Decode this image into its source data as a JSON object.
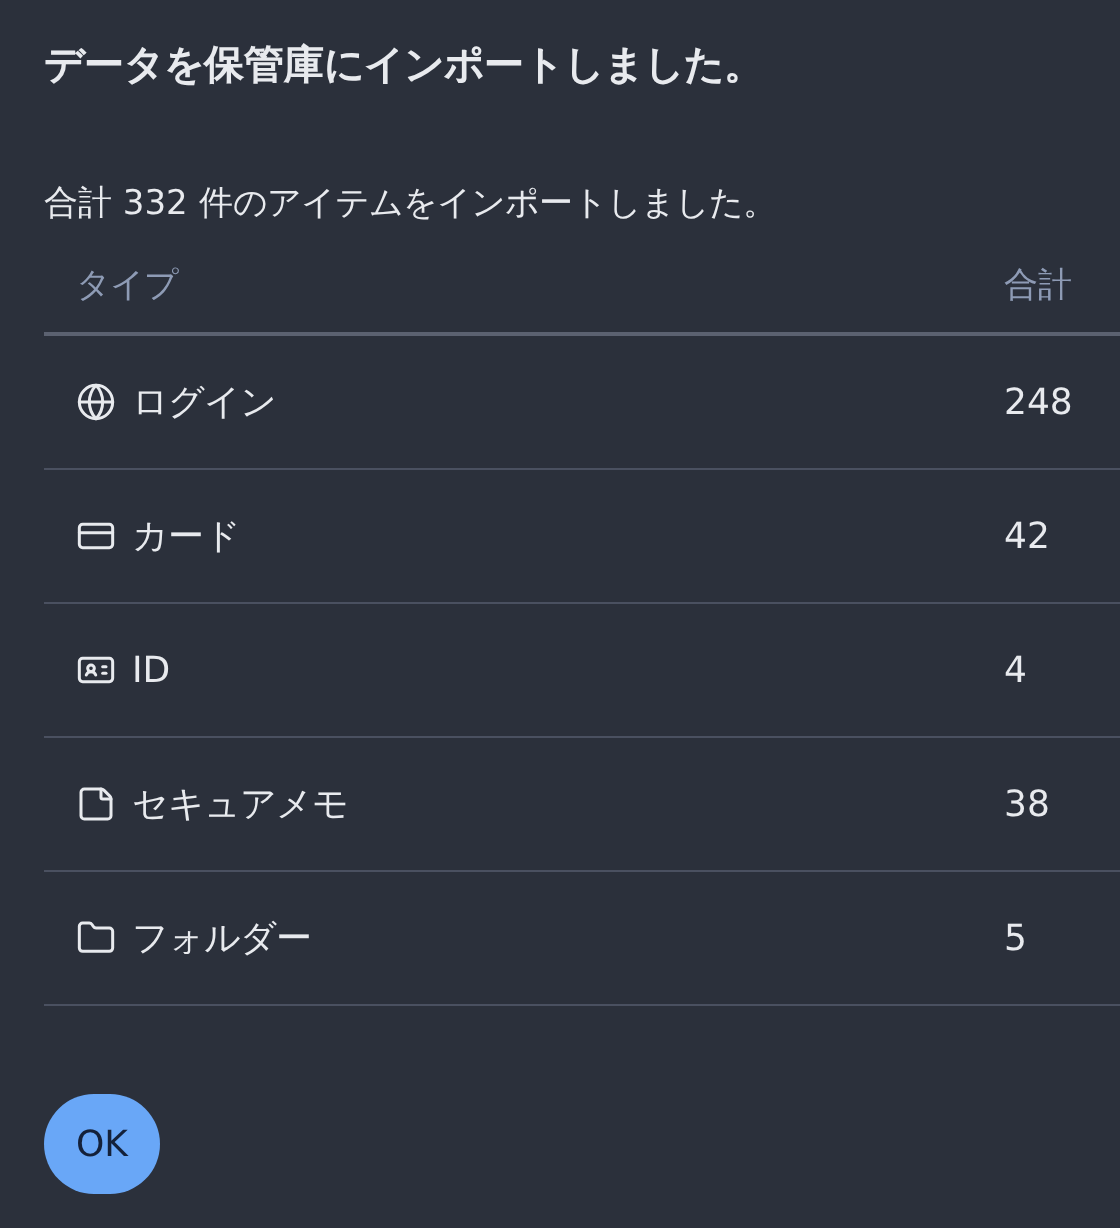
{
  "dialog": {
    "title": "データを保管庫にインポートしました。",
    "message": "合計 332 件のアイテムをインポートしました。"
  },
  "table": {
    "columns": [
      "タイプ",
      "合計"
    ],
    "rows": [
      {
        "kind": "login",
        "type": "ログイン",
        "count": "248"
      },
      {
        "kind": "card",
        "type": "カード",
        "count": "42"
      },
      {
        "kind": "identity",
        "type": "ID",
        "count": "4"
      },
      {
        "kind": "note",
        "type": "セキュアメモ",
        "count": "38"
      },
      {
        "kind": "folder",
        "type": "フォルダー",
        "count": "5"
      }
    ]
  },
  "buttons": [
    "OK"
  ]
}
